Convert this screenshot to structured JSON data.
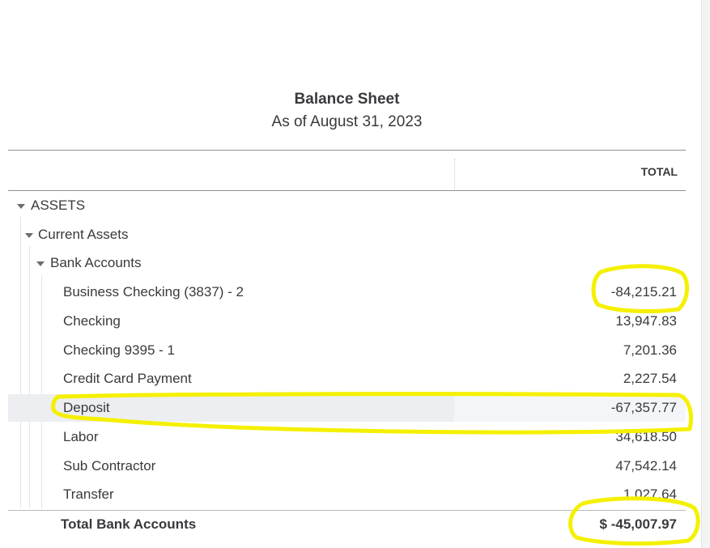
{
  "report": {
    "title": "Balance Sheet",
    "subtitle": "As of August 31, 2023",
    "column_header": "TOTAL"
  },
  "sections": {
    "assets": "ASSETS",
    "current_assets": "Current Assets",
    "bank_accounts": "Bank Accounts"
  },
  "rows": [
    {
      "label": "Business Checking (3837) - 2",
      "amount": "-84,215.21"
    },
    {
      "label": "Checking",
      "amount": "13,947.83"
    },
    {
      "label": "Checking 9395 - 1",
      "amount": "7,201.36"
    },
    {
      "label": "Credit Card Payment",
      "amount": "2,227.54"
    },
    {
      "label": "Deposit",
      "amount": "-67,357.77"
    },
    {
      "label": "Labor",
      "amount": "34,618.50"
    },
    {
      "label": "Sub Contractor",
      "amount": "47,542.14"
    },
    {
      "label": "Transfer",
      "amount": "1,027.64"
    }
  ],
  "total": {
    "label": "Total Bank Accounts",
    "amount": "$ -45,007.97"
  },
  "colors": {
    "annotation": "#f4f000",
    "highlight_row": "#eceef1",
    "text": "#393a3d"
  }
}
